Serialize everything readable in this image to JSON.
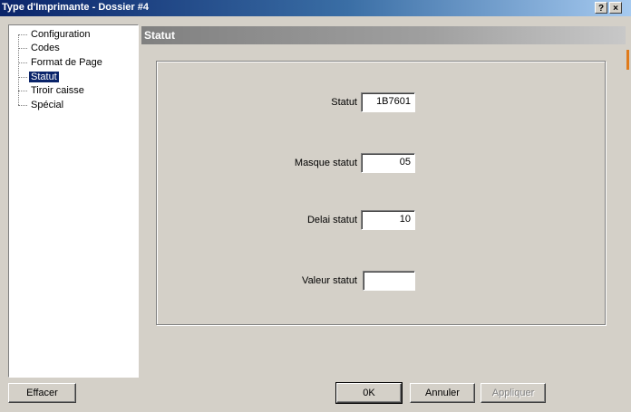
{
  "window": {
    "title": "Type d'Imprimante - Dossier #4",
    "help_button": "?",
    "close_button": "×"
  },
  "tree": {
    "items": [
      {
        "label": "Configuration",
        "selected": false
      },
      {
        "label": "Codes",
        "selected": false
      },
      {
        "label": "Format de Page",
        "selected": false
      },
      {
        "label": "Statut",
        "selected": true
      },
      {
        "label": "Tiroir caisse",
        "selected": false
      },
      {
        "label": "Spécial",
        "selected": false
      }
    ]
  },
  "panel": {
    "header": "Statut",
    "fields": {
      "statut": {
        "label": "Statut",
        "value": "1B7601"
      },
      "masque": {
        "label": "Masque statut",
        "value": "05"
      },
      "delai": {
        "label": "Delai statut",
        "value": "10"
      },
      "valeur": {
        "label": "Valeur statut",
        "value": ""
      }
    }
  },
  "buttons": {
    "effacer": "Effacer",
    "ok": "0K",
    "annuler": "Annuler",
    "appliquer": "Appliquer"
  }
}
